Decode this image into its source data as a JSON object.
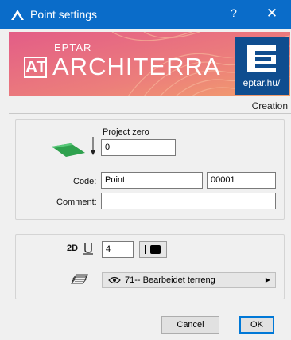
{
  "window": {
    "title": "Point settings",
    "help_label": "?",
    "close_label": "✕",
    "accent_color": "#0a6cc9"
  },
  "banner": {
    "logo_mark": "AT",
    "brand_small": "EPTAR",
    "brand_big": "ARCHITERRA",
    "badge_text": "eptar.hu/",
    "colors": {
      "pink": "#e8658a",
      "orange": "#ef9a6a",
      "badge": "#0f4d8f"
    }
  },
  "section_title": "Creation",
  "point_group": {
    "icon": "elevation-plane-icon",
    "project_zero_label": "Project zero",
    "project_zero_value": "0",
    "code_label": "Code:",
    "code_value": "Point",
    "code_number": "00001",
    "comment_label": "Comment:",
    "comment_value": ""
  },
  "display_group": {
    "display_2d_label": "2D",
    "pen_value": "4",
    "layer_icon": "layer-stack-icon",
    "layer_value": "71-- Bearbeidet terreng"
  },
  "footer": {
    "cancel_label": "Cancel",
    "ok_label": "OK"
  }
}
